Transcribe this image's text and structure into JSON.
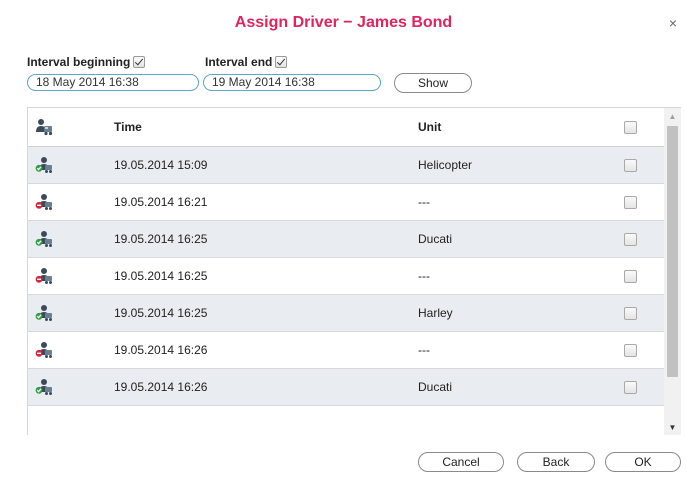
{
  "dialog": {
    "title": "Assign Driver − James Bond",
    "close_glyph": "×"
  },
  "filters": {
    "interval_beginning_label": "Interval beginning",
    "interval_beginning_checked": true,
    "interval_beginning_value": "18 May 2014 16:38",
    "interval_end_label": "Interval end",
    "interval_end_checked": true,
    "interval_end_value": "19 May 2014 16:38",
    "show_label": "Show"
  },
  "table": {
    "headers": {
      "icon": "driver-icon",
      "time": "Time",
      "unit": "Unit"
    },
    "rows": [
      {
        "status": "assigned",
        "time": "19.05.2014 15:09",
        "unit": "Helicopter"
      },
      {
        "status": "unassigned",
        "time": "19.05.2014 16:21",
        "unit": "---"
      },
      {
        "status": "assigned",
        "time": "19.05.2014 16:25",
        "unit": "Ducati"
      },
      {
        "status": "unassigned",
        "time": "19.05.2014 16:25",
        "unit": "---"
      },
      {
        "status": "assigned",
        "time": "19.05.2014 16:25",
        "unit": "Harley"
      },
      {
        "status": "unassigned",
        "time": "19.05.2014 16:26",
        "unit": "---"
      },
      {
        "status": "assigned",
        "time": "19.05.2014 16:26",
        "unit": "Ducati"
      }
    ]
  },
  "footer": {
    "cancel_label": "Cancel",
    "back_label": "Back",
    "ok_label": "OK"
  },
  "colors": {
    "title": "#e0245e",
    "assigned": "#2ea043",
    "unassigned": "#d9263c",
    "row_alt": "#e9ecf0",
    "input_border": "#5aa7c9"
  }
}
